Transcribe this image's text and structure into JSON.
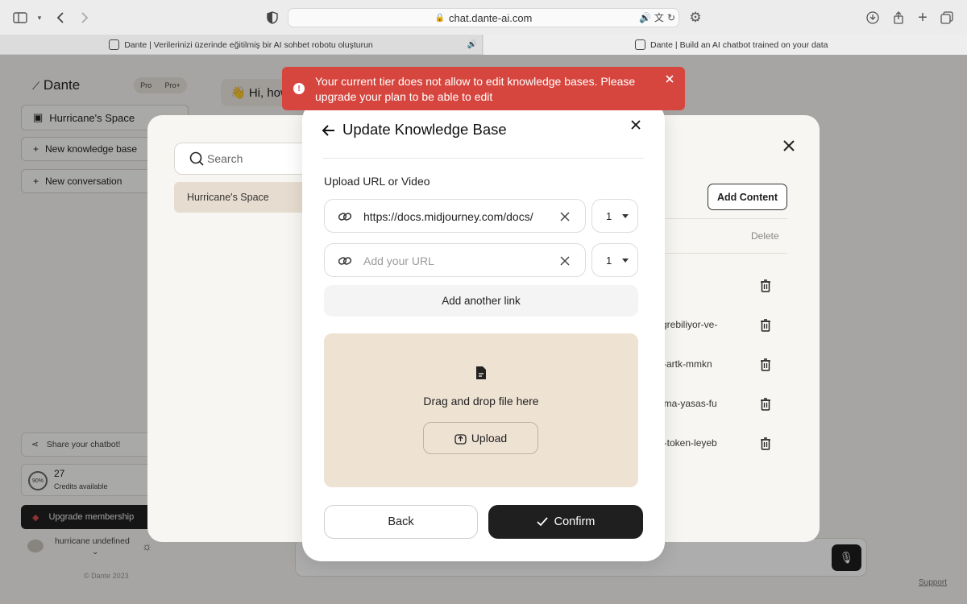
{
  "browser": {
    "url": "chat.dante-ai.com",
    "tabs": [
      {
        "title": "Dante | Verilerinizi üzerinde eğitilmiş bir AI sohbet robotu oluşturun"
      },
      {
        "title": "Dante | Build an AI chatbot trained on your data"
      }
    ]
  },
  "sidebar": {
    "logo": "Dante",
    "plan_options": [
      "Pro",
      "Pro+"
    ],
    "space_name": "Hurricane's Space",
    "new_kb_label": "New knowledge base",
    "new_conversation_label": "New conversation",
    "share_label": "Share your chatbot!",
    "credits_percent": "90%",
    "credits_count": "27",
    "credits_label": "Credits available",
    "upgrade_label": "Upgrade membership",
    "username": "hurricane undefined",
    "footer": "© Dante 2023"
  },
  "chat": {
    "greeting": "👋 Hi, how",
    "support_label": "Support"
  },
  "kb_modal": {
    "search_placeholder": "Search",
    "space_item": "Hurricane's Space",
    "add_content_label": "Add Content",
    "delete_header": "Delete",
    "rows": [
      {
        "text": ""
      },
      {
        "text": "-grebiliyor-ve-"
      },
      {
        "text": "k-artk-mmkn"
      },
      {
        "text": "ama-yasas-fu"
      },
      {
        "text": "n-token-leyeb"
      }
    ]
  },
  "update_modal": {
    "title": "Update Knowledge Base",
    "section_label": "Upload URL or Video",
    "url_1_value": "https://docs.midjourney.com/docs/",
    "url_2_placeholder": "Add your URL",
    "depth_1": "1",
    "depth_2": "1",
    "add_link_label": "Add another link",
    "drop_text": "Drag and drop file here",
    "upload_label": "Upload",
    "back_label": "Back",
    "confirm_label": "Confirm"
  },
  "toast": {
    "message": "Your current tier does not allow to edit knowledge bases. Please upgrade your plan to be able to edit",
    "color": "#d7463e"
  }
}
